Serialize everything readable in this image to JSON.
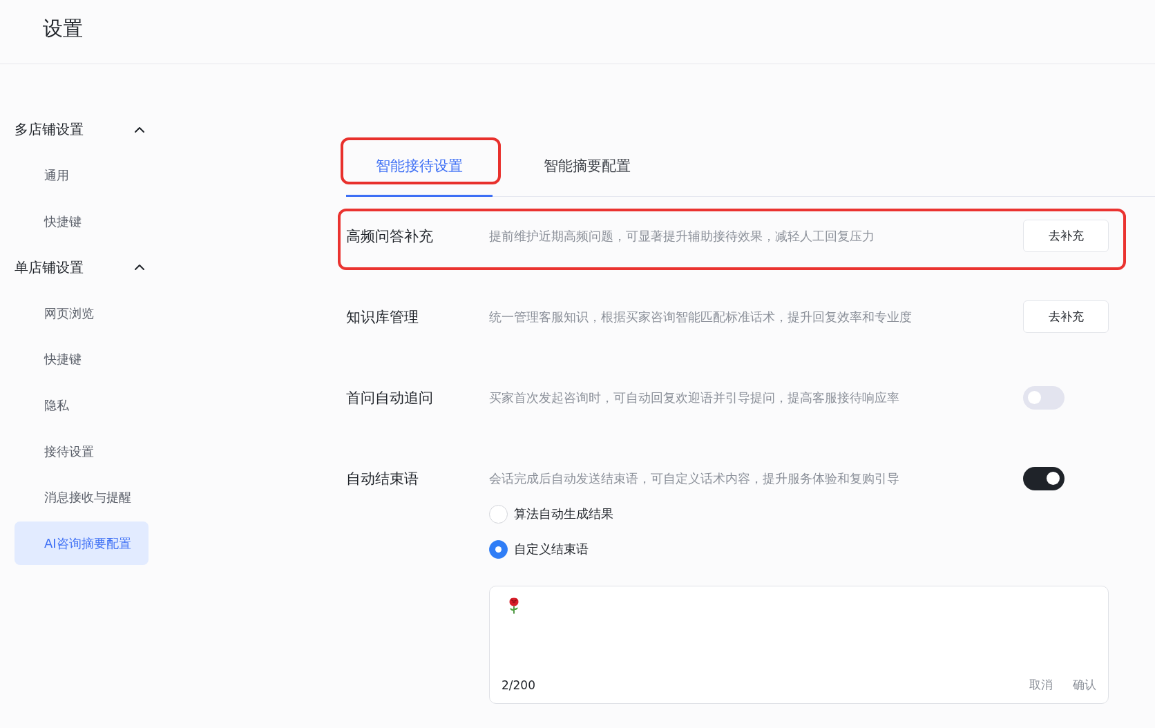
{
  "header": {
    "title": "设置"
  },
  "sidebar": {
    "groups": [
      {
        "label": "多店铺设置",
        "expanded": true,
        "items": [
          {
            "label": "通用",
            "selected": false
          },
          {
            "label": "快捷键",
            "selected": false
          }
        ]
      },
      {
        "label": "单店铺设置",
        "expanded": true,
        "items": [
          {
            "label": "网页浏览",
            "selected": false
          },
          {
            "label": "快捷键",
            "selected": false
          },
          {
            "label": "隐私",
            "selected": false
          },
          {
            "label": "接待设置",
            "selected": false
          },
          {
            "label": "消息接收与提醒",
            "selected": false
          },
          {
            "label": "AI咨询摘要配置",
            "selected": true
          }
        ]
      }
    ]
  },
  "tabs": [
    {
      "label": "智能接待设置",
      "selected": true,
      "highlighted": true
    },
    {
      "label": "智能摘要配置",
      "selected": false,
      "highlighted": false
    }
  ],
  "settings": [
    {
      "kind": "button",
      "title": "高频问答补充",
      "description": "提前维护近期高频问题，可显著提升辅助接待效果，减轻人工回复压力",
      "button": "去补充",
      "highlighted": true
    },
    {
      "kind": "button",
      "title": "知识库管理",
      "description": "统一管理客服知识，根据买家咨询智能匹配标准话术，提升回复效率和专业度",
      "button": "去补充",
      "highlighted": false
    },
    {
      "kind": "toggle",
      "title": "首问自动追问",
      "description": "买家首次发起咨询时，可自动回复欢迎语并引导提问，提高客服接待响应率",
      "on": false,
      "highlighted": false
    },
    {
      "kind": "toggle",
      "title": "自动结束语",
      "description": "会话完成后自动发送结束语，可自定义话术内容，提升服务体验和复购引导",
      "on": true,
      "highlighted": false,
      "options": [
        {
          "label": "算法自动生成结果",
          "selected": false
        },
        {
          "label": "自定义结束语",
          "selected": true
        }
      ],
      "editor": {
        "count": "2/200",
        "actions": [
          "取消",
          "确认"
        ]
      }
    }
  ]
}
